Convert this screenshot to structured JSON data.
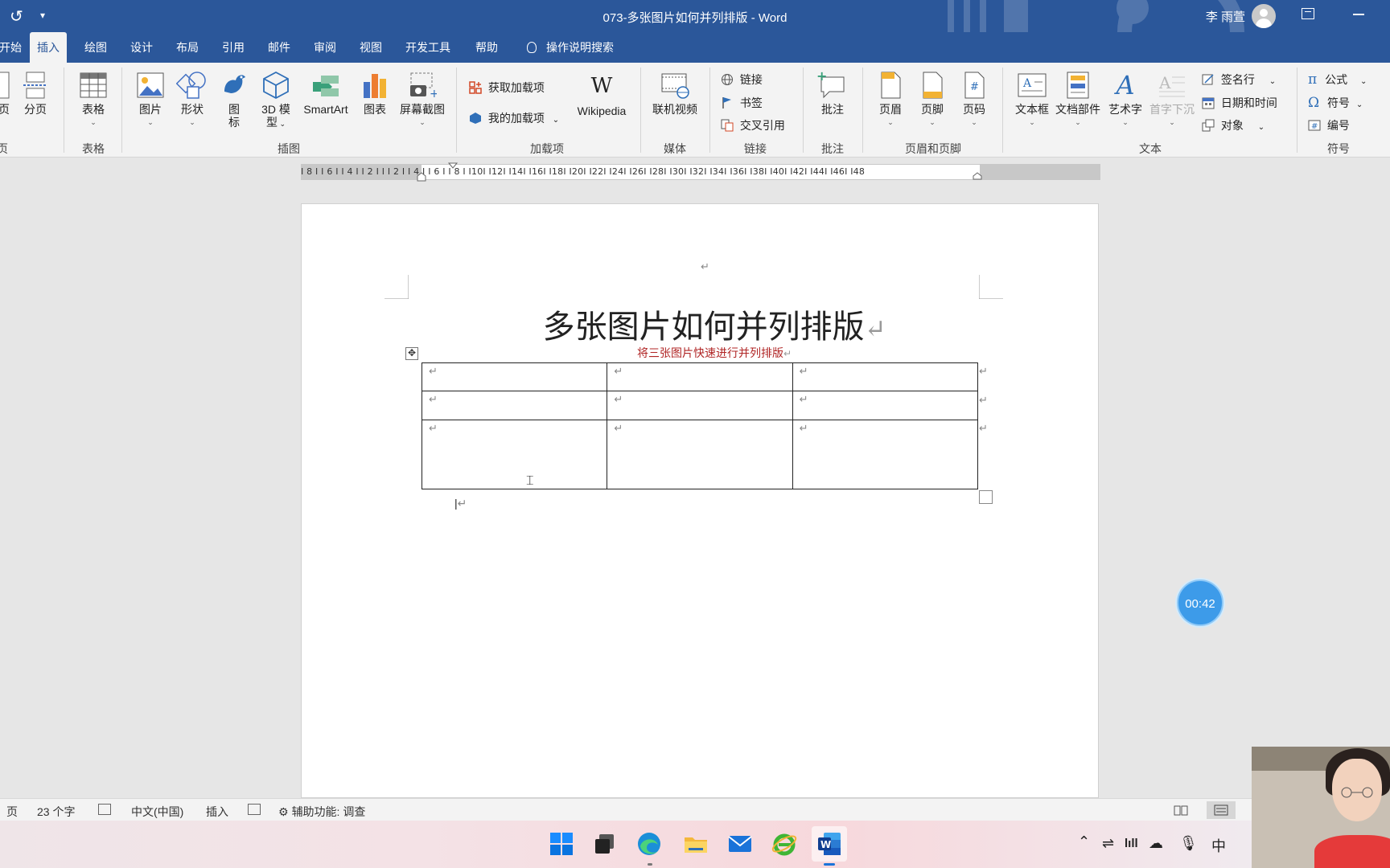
{
  "titlebar": {
    "undo_icon": "refresh-icon",
    "qat_icon": "customize-qat-icon",
    "document_title": "073-多张图片如何并列排版  -  Word",
    "user_name": "李 雨萱"
  },
  "tabs": [
    {
      "label": "开始",
      "active": false
    },
    {
      "label": "插入",
      "active": true
    },
    {
      "label": "绘图",
      "active": false
    },
    {
      "label": "设计",
      "active": false
    },
    {
      "label": "布局",
      "active": false
    },
    {
      "label": "引用",
      "active": false
    },
    {
      "label": "邮件",
      "active": false
    },
    {
      "label": "审阅",
      "active": false
    },
    {
      "label": "视图",
      "active": false
    },
    {
      "label": "开发工具",
      "active": false
    },
    {
      "label": "帮助",
      "active": false
    },
    {
      "label": "操作说明搜索",
      "active": false
    }
  ],
  "ribbon": {
    "pages": {
      "page_label": "页",
      "page_break": "分页",
      "group": "页"
    },
    "tables": {
      "table": "表格",
      "group": "表格"
    },
    "illustrations": {
      "picture": "图片",
      "shapes": "形状",
      "icons_1": "图",
      "icons_2": "标",
      "model_1": "3D 模",
      "model_2": "型",
      "smartart": "SmartArt",
      "chart": "图表",
      "screenshot": "屏幕截图",
      "group": "插图"
    },
    "addins": {
      "get": "获取加载项",
      "mine": "我的加载项",
      "wikipedia": "Wikipedia",
      "group": "加载项"
    },
    "media": {
      "online_video": "联机视频",
      "group": "媒体"
    },
    "links": {
      "link": "链接",
      "bookmark": "书签",
      "cross_ref": "交叉引用",
      "group": "链接"
    },
    "comments": {
      "comment": "批注",
      "group": "批注"
    },
    "header_footer": {
      "header": "页眉",
      "footer": "页脚",
      "page_number": "页码",
      "group": "页眉和页脚"
    },
    "text": {
      "textbox": "文本框",
      "quick_parts": "文档部件",
      "wordart": "艺术字",
      "dropcap": "首字下沉",
      "signature": "签名行",
      "datetime": "日期和时间",
      "object": "对象",
      "group": "文本"
    },
    "symbols": {
      "equation": "公式",
      "symbol": "符号",
      "number": "编号",
      "group": "符号"
    }
  },
  "ruler": {
    "text": "I 8 I  I 6 I  I 4 I  I 2 I    I   I 2 I  I 4 I  I 6 I  I 8 I  I10I  I12I  I14I  I16I  I18I  I20I  I22I  I24I  I26I  I28I  I30I  I32I  I34I  I36I  I38I  I40I  I42I  I44I  I46I  I48"
  },
  "document": {
    "title": "多张图片如何并列排版",
    "subtitle": "将三张图片快速进行并列排版",
    "paragraph_mark": "↵",
    "table": {
      "rows": [
        [
          "↵",
          "↵",
          "↵"
        ],
        [
          "↵",
          "↵",
          "↵"
        ],
        [
          "↵",
          "↵",
          "↵"
        ]
      ]
    }
  },
  "timer": {
    "value": "00:42"
  },
  "statusbar": {
    "page": "页",
    "word_count": "23 个字",
    "language": "中文(中国)",
    "mode": "插入",
    "accessibility": "辅助功能: 调查"
  },
  "taskbar": {
    "icons": [
      "windows-start-icon",
      "task-view-icon",
      "edge-icon",
      "file-explorer-icon",
      "mail-icon",
      "ie-icon",
      "word-icon"
    ],
    "tray_ime": "中"
  },
  "colors": {
    "word_blue": "#2b579a",
    "subtitle_red": "#b02525",
    "timer_blue": "#3d9be9"
  }
}
